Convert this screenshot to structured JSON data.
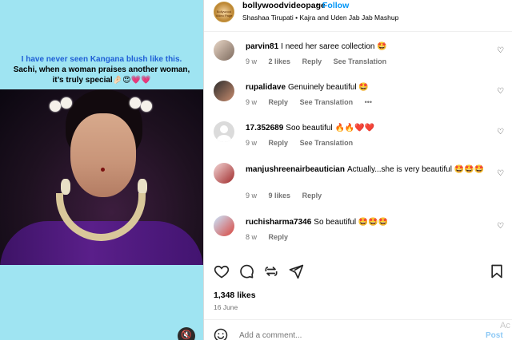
{
  "media": {
    "caption_line1": "I have never seen Kangana blush like this.",
    "caption_rest": "Sachi, when a woman praises another woman, it’s truly special🤌🏻😍💗💗",
    "mute_icon": "speaker-muted-icon"
  },
  "header": {
    "username": "bollywoodvideopage",
    "separator": "•",
    "follow": "Follow",
    "audio": "Shashaa Tirupati • Kajra and Uden Jab Jab Mashup",
    "avatar_text": "Bollywood Video Page"
  },
  "comments": [
    {
      "user": "parvin81",
      "text": "I need her saree collection 🤩",
      "time": "9 w",
      "likes": "2 likes",
      "reply": "Reply",
      "translate": "See Translation",
      "more": ""
    },
    {
      "user": "rupalidave",
      "text": "Genuinely beautiful 🤩",
      "time": "9 w",
      "likes": "",
      "reply": "Reply",
      "translate": "See Translation",
      "more": "•••"
    },
    {
      "user": "17.352689",
      "text": "Soo beautiful 🔥🔥❤️❤️",
      "time": "9 w",
      "likes": "",
      "reply": "Reply",
      "translate": "See Translation",
      "more": ""
    },
    {
      "user": "manjushreenairbeautician",
      "text": "Actually...she is very beautiful 🤩🤩🤩",
      "time": "9 w",
      "likes": "9 likes",
      "reply": "Reply",
      "translate": "",
      "more": ""
    },
    {
      "user": "ruchisharma7346",
      "text": "So beautiful 🤩🤩🤩",
      "time": "8 w",
      "likes": "",
      "reply": "Reply",
      "translate": "",
      "more": ""
    }
  ],
  "actions": {
    "like_icon": "heart-icon",
    "comment_icon": "comment-bubble-icon",
    "share_icon": "repost-icon",
    "send_icon": "send-paper-plane-icon",
    "save_icon": "bookmark-icon"
  },
  "likes": "1,348 likes",
  "date": "16 June",
  "add_comment": {
    "placeholder": "Add a comment...",
    "post": "Post",
    "emoji_icon": "smiley-icon"
  },
  "watermark": "Ac"
}
